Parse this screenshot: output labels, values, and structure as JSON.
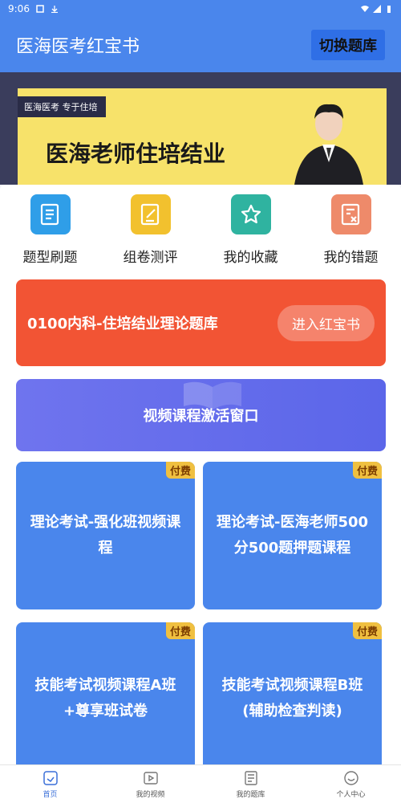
{
  "status_bar": {
    "time": "9:06"
  },
  "header": {
    "title": "医海医考红宝书",
    "switch_label": "切换题库"
  },
  "banner": {
    "tag": "医海医考 专于住培",
    "headline": "医海老师住培结业"
  },
  "quick_actions": [
    {
      "label": "题型刷题",
      "icon": "question-list-icon",
      "color": "#2f9ee8"
    },
    {
      "label": "组卷测评",
      "icon": "edit-paper-icon",
      "color": "#f2c12e"
    },
    {
      "label": "我的收藏",
      "icon": "star-icon",
      "color": "#2fb3a0"
    },
    {
      "label": "我的错题",
      "icon": "wrong-note-icon",
      "color": "#ee8a6a"
    }
  ],
  "question_bank": {
    "title": "0100内科-住培结业理论题库",
    "enter_label": "进入红宝书"
  },
  "video_activation": {
    "label": "视频课程激活窗口"
  },
  "courses": [
    {
      "title": "理论考试-强化班视频课程",
      "badge": "付费"
    },
    {
      "title": "理论考试-医海老师500分500题押题课程",
      "badge": "付费"
    },
    {
      "title": "技能考试视频课程A班+尊享班试卷",
      "badge": "付费"
    },
    {
      "title": "技能考试视频课程B班(辅助检查判读)",
      "badge": "付费"
    }
  ],
  "bottom_nav": [
    {
      "label": "首页",
      "icon": "home-icon",
      "active": true
    },
    {
      "label": "我的视频",
      "icon": "video-icon",
      "active": false
    },
    {
      "label": "我的题库",
      "icon": "question-bank-icon",
      "active": false
    },
    {
      "label": "个人中心",
      "icon": "profile-icon",
      "active": false
    }
  ],
  "colors": {
    "primary": "#4a86ec",
    "red_card": "#f25434",
    "video_card": "#6f74ee",
    "badge": "#f0c040"
  }
}
